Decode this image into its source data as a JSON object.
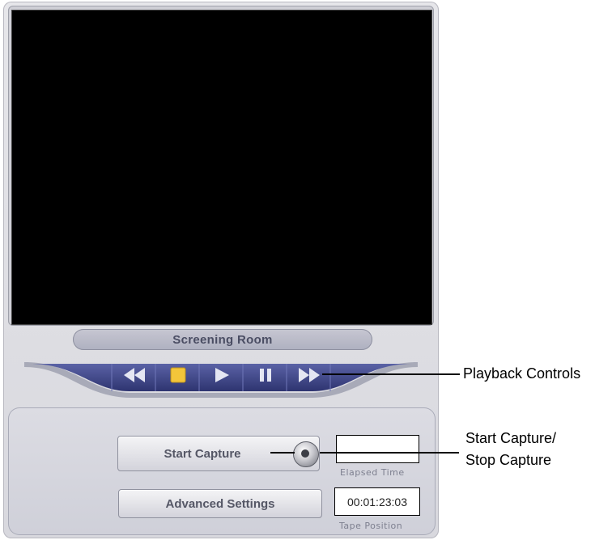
{
  "screen": {
    "label": "Screening Room"
  },
  "playback": {
    "buttons": [
      {
        "name": "rewind",
        "icon": "rewind-icon"
      },
      {
        "name": "stop",
        "icon": "stop-icon"
      },
      {
        "name": "play",
        "icon": "play-icon"
      },
      {
        "name": "pause",
        "icon": "pause-icon"
      },
      {
        "name": "fast-forward",
        "icon": "fast-forward-icon"
      }
    ]
  },
  "capture": {
    "start_label": "Start Capture",
    "advanced_label": "Advanced Settings",
    "elapsed_time_value": "",
    "elapsed_time_caption": "Elapsed Time",
    "tape_position_value": "00:01:23:03",
    "tape_position_caption": "Tape Position"
  },
  "callouts": {
    "playback": "Playback Controls",
    "capture_line1": "Start Capture/",
    "capture_line2": "Stop Capture"
  },
  "colors": {
    "accent_bar": "#3d4486",
    "stop_button": "#f3c53a",
    "screen": "#000000"
  }
}
